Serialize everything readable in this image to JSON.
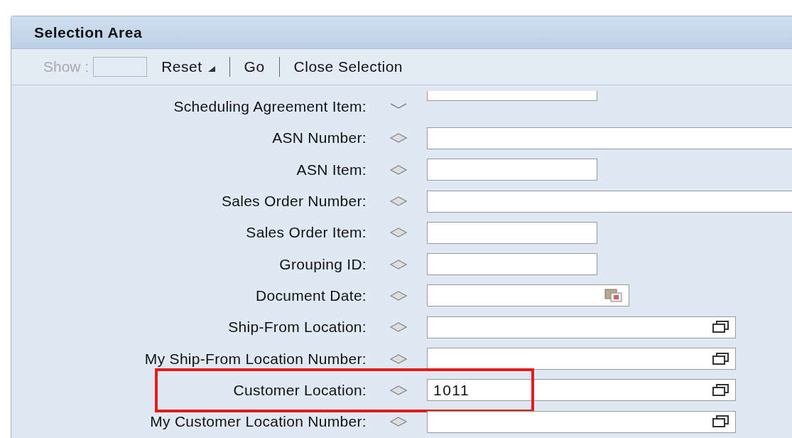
{
  "panel": {
    "title": "Selection Area"
  },
  "toolbar": {
    "show_label": "Show :",
    "show_disabled": true,
    "items": [
      {
        "label": "Reset",
        "kind": "menu"
      },
      {
        "label": "Go",
        "kind": "plain"
      },
      {
        "label": "Close Selection",
        "kind": "plain"
      }
    ]
  },
  "fields": [
    {
      "label": "Scheduling Agreement Item:",
      "expanded": true,
      "kind": "short",
      "highlighted": false
    },
    {
      "label": "ASN Number:",
      "expanded": false,
      "kind": "long",
      "highlighted": false
    },
    {
      "label": "ASN Item:",
      "expanded": false,
      "kind": "short",
      "highlighted": false
    },
    {
      "label": "Sales Order Number:",
      "expanded": false,
      "kind": "long",
      "highlighted": false
    },
    {
      "label": "Sales Order Item:",
      "expanded": false,
      "kind": "short",
      "highlighted": false
    },
    {
      "label": "Grouping ID:",
      "expanded": false,
      "kind": "short",
      "highlighted": false
    },
    {
      "label": "Document Date:",
      "expanded": false,
      "kind": "date",
      "highlighted": false
    },
    {
      "label": "Ship-From Location:",
      "expanded": false,
      "kind": "help",
      "highlighted": false
    },
    {
      "label": "My Ship-From Location Number:",
      "expanded": false,
      "kind": "help",
      "highlighted": false
    },
    {
      "label": "Customer Location:",
      "expanded": false,
      "kind": "help",
      "value": "1011",
      "highlighted": true
    },
    {
      "label": "My Customer Location Number:",
      "expanded": false,
      "kind": "help",
      "highlighted": false
    }
  ]
}
